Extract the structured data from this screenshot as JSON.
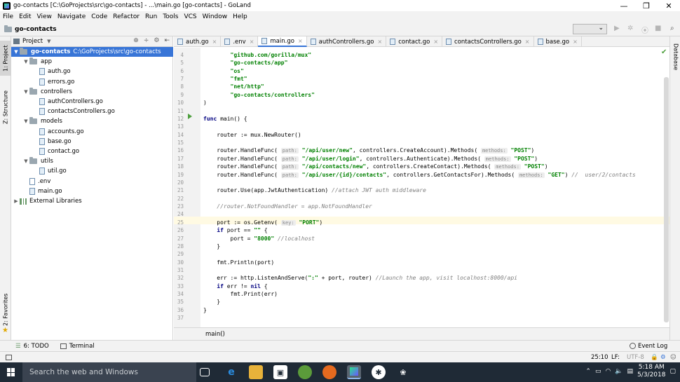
{
  "window": {
    "title": "go-contacts [C:\\GoProjects\\src\\go-contacts] - ...\\main.go [go-contacts] - GoLand",
    "minimize": "—",
    "maximize": "❐",
    "close": "✕"
  },
  "menu": [
    "File",
    "Edit",
    "View",
    "Navigate",
    "Code",
    "Refactor",
    "Run",
    "Tools",
    "VCS",
    "Window",
    "Help"
  ],
  "breadcrumb": "go-contacts",
  "sidestrip": {
    "project": "1: Project",
    "structure": "Z: Structure",
    "favorites": "2: Favorites",
    "database": "Database"
  },
  "project_panel": {
    "title": "Project",
    "tree": [
      {
        "label": "go-contacts",
        "suffix": "C:\\GoProjects\\src\\go-contacts",
        "depth": 0,
        "type": "folder",
        "expanded": true,
        "selected": true
      },
      {
        "label": "app",
        "depth": 1,
        "type": "folder",
        "expanded": true
      },
      {
        "label": "auth.go",
        "depth": 2,
        "type": "go"
      },
      {
        "label": "errors.go",
        "depth": 2,
        "type": "go"
      },
      {
        "label": "controllers",
        "depth": 1,
        "type": "folder",
        "expanded": true
      },
      {
        "label": "authControllers.go",
        "depth": 2,
        "type": "go"
      },
      {
        "label": "contactsControllers.go",
        "depth": 2,
        "type": "go"
      },
      {
        "label": "models",
        "depth": 1,
        "type": "folder",
        "expanded": true
      },
      {
        "label": "accounts.go",
        "depth": 2,
        "type": "go"
      },
      {
        "label": "base.go",
        "depth": 2,
        "type": "go"
      },
      {
        "label": "contact.go",
        "depth": 2,
        "type": "go"
      },
      {
        "label": "utils",
        "depth": 1,
        "type": "folder",
        "expanded": true
      },
      {
        "label": "util.go",
        "depth": 2,
        "type": "go"
      },
      {
        "label": ".env",
        "depth": 1,
        "type": "file"
      },
      {
        "label": "main.go",
        "depth": 1,
        "type": "go"
      },
      {
        "label": "External Libraries",
        "depth": 0,
        "type": "lib",
        "expanded": false
      }
    ]
  },
  "tabs": [
    {
      "label": "auth.go",
      "active": false
    },
    {
      "label": ".env",
      "active": false
    },
    {
      "label": "main.go",
      "active": true
    },
    {
      "label": "authControllers.go",
      "active": false
    },
    {
      "label": "contact.go",
      "active": false
    },
    {
      "label": "contactsControllers.go",
      "active": false
    },
    {
      "label": "base.go",
      "active": false
    }
  ],
  "code": [
    {
      "n": "4",
      "html": "        <span class=\"str\">\"github.com/gorilla/mux\"</span>"
    },
    {
      "n": "5",
      "html": "        <span class=\"str\">\"go-contacts/app\"</span>"
    },
    {
      "n": "6",
      "html": "        <span class=\"str\">\"os\"</span>"
    },
    {
      "n": "7",
      "html": "        <span class=\"str\">\"fmt\"</span>"
    },
    {
      "n": "8",
      "html": "        <span class=\"str\">\"net/http\"</span>"
    },
    {
      "n": "9",
      "html": "        <span class=\"str\">\"go-contacts/controllers\"</span>"
    },
    {
      "n": "10",
      "html": ")"
    },
    {
      "n": "11",
      "html": ""
    },
    {
      "n": "12",
      "html": "<span class=\"kw\">func</span> main() {"
    },
    {
      "n": "13",
      "html": ""
    },
    {
      "n": "14",
      "html": "    router := mux.NewRouter()"
    },
    {
      "n": "15",
      "html": ""
    },
    {
      "n": "16",
      "html": "    router.HandleFunc( <span class=\"hint\">path:</span> <span class=\"str\">\"/api/user/new\"</span>, controllers.CreateAccount).Methods( <span class=\"hint\">methods:</span> <span class=\"str\">\"POST\"</span>)"
    },
    {
      "n": "17",
      "html": "    router.HandleFunc( <span class=\"hint\">path:</span> <span class=\"str\">\"/api/user/login\"</span>, controllers.Authenticate).Methods( <span class=\"hint\">methods:</span> <span class=\"str\">\"POST\"</span>)"
    },
    {
      "n": "18",
      "html": "    router.HandleFunc( <span class=\"hint\">path:</span> <span class=\"str\">\"/api/contacts/new\"</span>, controllers.CreateContact).Methods( <span class=\"hint\">methods:</span> <span class=\"str\">\"POST\"</span>)"
    },
    {
      "n": "19",
      "html": "    router.HandleFunc( <span class=\"hint\">path:</span> <span class=\"str\">\"/api/user/{id}/contacts\"</span>, controllers.GetContactsFor).Methods( <span class=\"hint\">methods:</span> <span class=\"str\">\"GET\"</span>) <span class=\"cm\">//  user/2/contacts</span>"
    },
    {
      "n": "20",
      "html": ""
    },
    {
      "n": "21",
      "html": "    router.Use(app.JwtAuthentication) <span class=\"cm\">//attach JWT auth middleware</span>"
    },
    {
      "n": "22",
      "html": ""
    },
    {
      "n": "23",
      "html": "    <span class=\"cm\">//router.NotFoundHandler = app.NotFoundHandler</span>"
    },
    {
      "n": "24",
      "html": ""
    },
    {
      "n": "25",
      "html": "    port := os.Getenv( <span class=\"hint\">key:</span> <span class=\"str\">\"PORT\"</span>)"
    },
    {
      "n": "26",
      "html": "    <span class=\"kw\">if</span> port == <span class=\"str\">\"\"</span> {"
    },
    {
      "n": "27",
      "html": "        port = <span class=\"str\">\"8000\"</span> <span class=\"cm\">//localhost</span>"
    },
    {
      "n": "28",
      "html": "    }"
    },
    {
      "n": "29",
      "html": ""
    },
    {
      "n": "30",
      "html": "    fmt.Println(port)"
    },
    {
      "n": "31",
      "html": ""
    },
    {
      "n": "32",
      "html": "    err := http.ListenAndServe(<span class=\"str\">\":\"</span> + port, router) <span class=\"cm\">//Launch the app, visit localhost:8000/api</span>"
    },
    {
      "n": "33",
      "html": "    <span class=\"kw\">if</span> err != <span class=\"kw\">nil</span> {"
    },
    {
      "n": "34",
      "html": "        fmt.Print(err)"
    },
    {
      "n": "35",
      "html": "    }"
    },
    {
      "n": "36",
      "html": "}"
    },
    {
      "n": "37",
      "html": ""
    }
  ],
  "editor_breadcrumb": "main()",
  "toolwindows": {
    "todo": "6: TODO",
    "terminal": "Terminal",
    "eventlog": "Event Log"
  },
  "status": {
    "position": "25:10",
    "line_sep": "LF:",
    "encoding": "UTF-8"
  },
  "taskbar": {
    "search_placeholder": "Search the web and Windows",
    "time": "5:18 AM",
    "date": "5/3/2018"
  },
  "colors": {
    "selection": "#3875d7",
    "string": "#008000",
    "keyword": "#000080",
    "comment": "#808080"
  }
}
